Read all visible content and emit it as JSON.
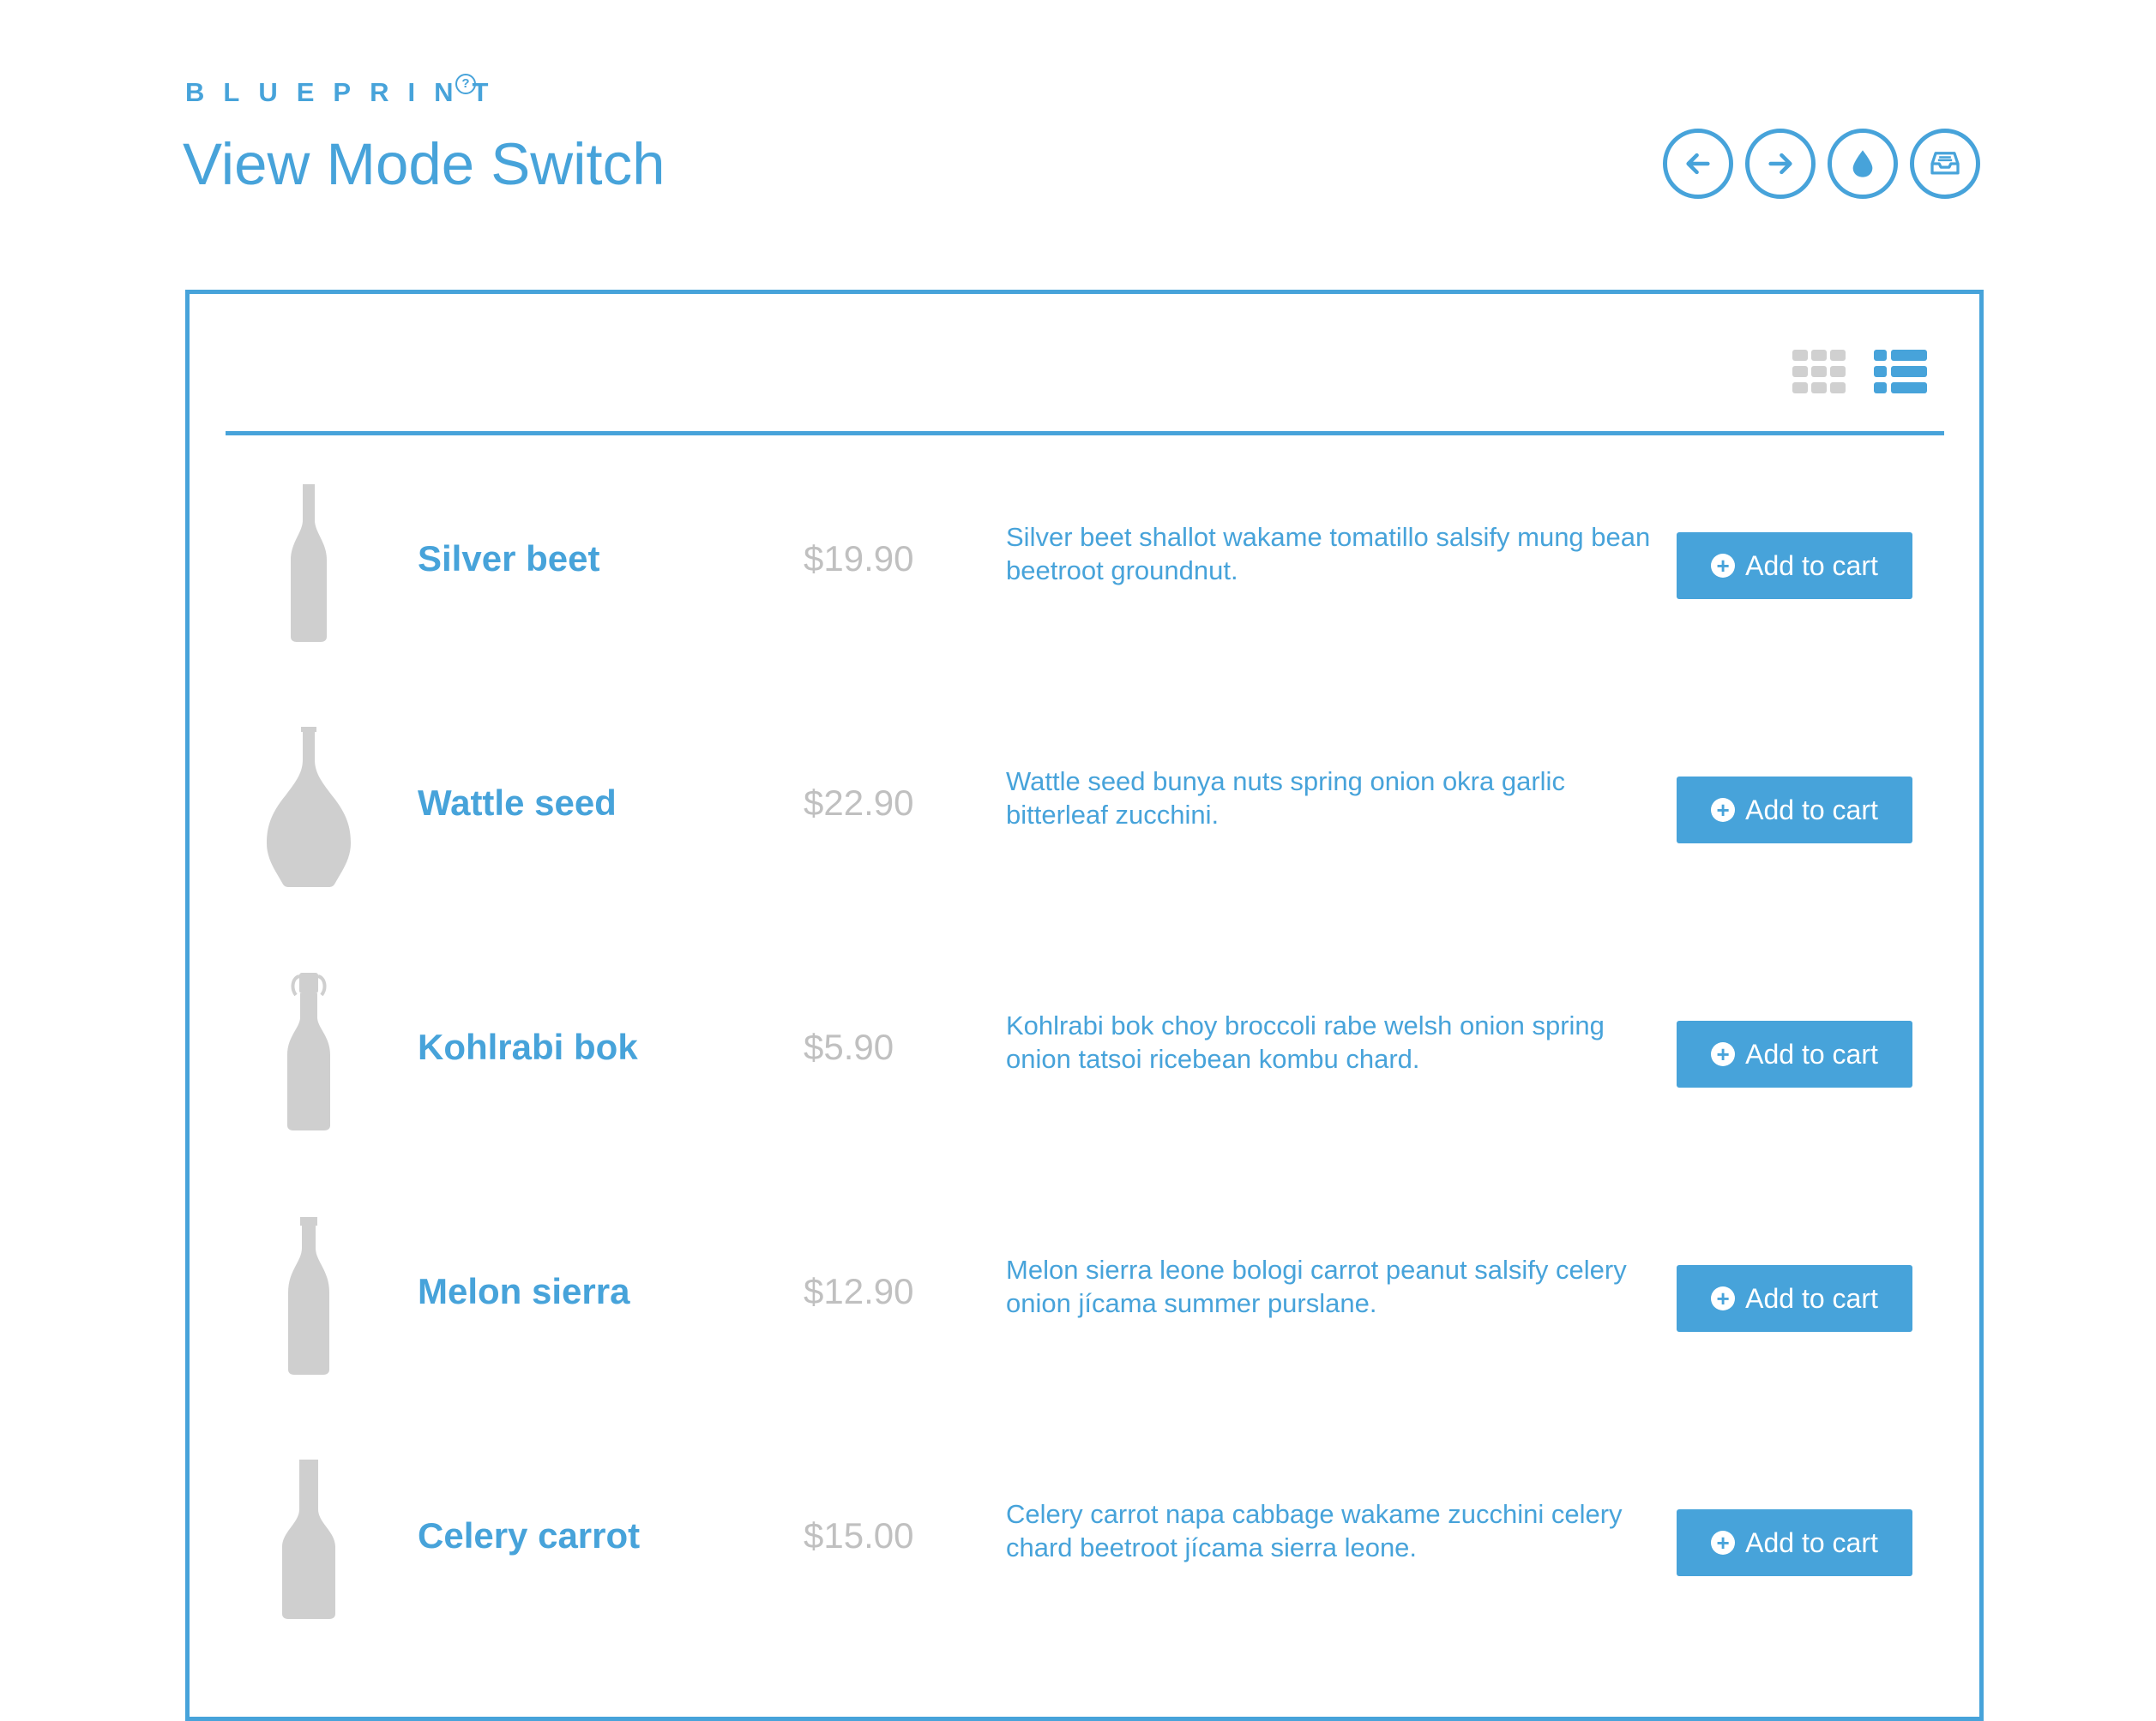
{
  "header": {
    "brand": "BLUEPRINT",
    "brand_help": "?",
    "title": "View Mode Switch",
    "nav": [
      {
        "name": "previous",
        "icon": "arrow-left-icon"
      },
      {
        "name": "next",
        "icon": "arrow-right-icon"
      },
      {
        "name": "theme",
        "icon": "droplet-icon"
      },
      {
        "name": "archive",
        "icon": "inbox-icon"
      }
    ]
  },
  "view_modes": {
    "options": [
      "grid",
      "list"
    ],
    "selected": "list"
  },
  "colors": {
    "accent": "#47a3da",
    "muted": "#c0c0c0",
    "inactive": "#d0d0d0"
  },
  "products": [
    {
      "name": "Silver beet",
      "price": "$19.90",
      "description": "Silver beet shallot wakame tomatillo salsify mung bean beetroot groundnut.",
      "button": "Add to cart",
      "image": "tall-bottle"
    },
    {
      "name": "Wattle seed",
      "price": "$22.90",
      "description": "Wattle seed bunya nuts spring onion okra garlic bitterleaf zucchini.",
      "button": "Add to cart",
      "image": "round-decanter-bottle"
    },
    {
      "name": "Kohlrabi bok",
      "price": "$5.90",
      "description": "Kohlrabi bok choy broccoli rabe welsh onion spring onion tatsoi ricebean kombu chard.",
      "button": "Add to cart",
      "image": "swing-top-bottle"
    },
    {
      "name": "Melon sierra",
      "price": "$12.90",
      "description": "Melon sierra leone bologi carrot peanut salsify celery onion jícama summer purslane.",
      "button": "Add to cart",
      "image": "beer-bottle"
    },
    {
      "name": "Celery carrot",
      "price": "$15.00",
      "description": "Celery carrot napa cabbage wakame zucchini celery chard beetroot jícama sierra leone.",
      "button": "Add to cart",
      "image": "square-liquor-bottle"
    }
  ]
}
